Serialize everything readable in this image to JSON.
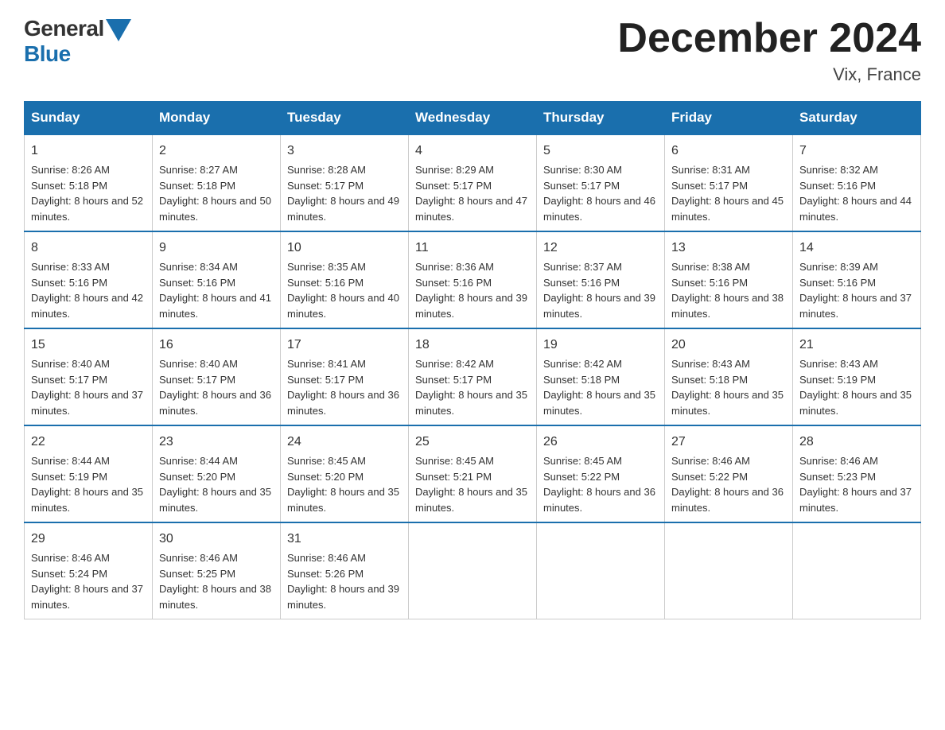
{
  "logo": {
    "general": "General",
    "blue": "Blue"
  },
  "header": {
    "title": "December 2024",
    "location": "Vix, France"
  },
  "days_of_week": [
    "Sunday",
    "Monday",
    "Tuesday",
    "Wednesday",
    "Thursday",
    "Friday",
    "Saturday"
  ],
  "weeks": [
    [
      {
        "num": "1",
        "sunrise": "8:26 AM",
        "sunset": "5:18 PM",
        "daylight": "8 hours and 52 minutes."
      },
      {
        "num": "2",
        "sunrise": "8:27 AM",
        "sunset": "5:18 PM",
        "daylight": "8 hours and 50 minutes."
      },
      {
        "num": "3",
        "sunrise": "8:28 AM",
        "sunset": "5:17 PM",
        "daylight": "8 hours and 49 minutes."
      },
      {
        "num": "4",
        "sunrise": "8:29 AM",
        "sunset": "5:17 PM",
        "daylight": "8 hours and 47 minutes."
      },
      {
        "num": "5",
        "sunrise": "8:30 AM",
        "sunset": "5:17 PM",
        "daylight": "8 hours and 46 minutes."
      },
      {
        "num": "6",
        "sunrise": "8:31 AM",
        "sunset": "5:17 PM",
        "daylight": "8 hours and 45 minutes."
      },
      {
        "num": "7",
        "sunrise": "8:32 AM",
        "sunset": "5:16 PM",
        "daylight": "8 hours and 44 minutes."
      }
    ],
    [
      {
        "num": "8",
        "sunrise": "8:33 AM",
        "sunset": "5:16 PM",
        "daylight": "8 hours and 42 minutes."
      },
      {
        "num": "9",
        "sunrise": "8:34 AM",
        "sunset": "5:16 PM",
        "daylight": "8 hours and 41 minutes."
      },
      {
        "num": "10",
        "sunrise": "8:35 AM",
        "sunset": "5:16 PM",
        "daylight": "8 hours and 40 minutes."
      },
      {
        "num": "11",
        "sunrise": "8:36 AM",
        "sunset": "5:16 PM",
        "daylight": "8 hours and 39 minutes."
      },
      {
        "num": "12",
        "sunrise": "8:37 AM",
        "sunset": "5:16 PM",
        "daylight": "8 hours and 39 minutes."
      },
      {
        "num": "13",
        "sunrise": "8:38 AM",
        "sunset": "5:16 PM",
        "daylight": "8 hours and 38 minutes."
      },
      {
        "num": "14",
        "sunrise": "8:39 AM",
        "sunset": "5:16 PM",
        "daylight": "8 hours and 37 minutes."
      }
    ],
    [
      {
        "num": "15",
        "sunrise": "8:40 AM",
        "sunset": "5:17 PM",
        "daylight": "8 hours and 37 minutes."
      },
      {
        "num": "16",
        "sunrise": "8:40 AM",
        "sunset": "5:17 PM",
        "daylight": "8 hours and 36 minutes."
      },
      {
        "num": "17",
        "sunrise": "8:41 AM",
        "sunset": "5:17 PM",
        "daylight": "8 hours and 36 minutes."
      },
      {
        "num": "18",
        "sunrise": "8:42 AM",
        "sunset": "5:17 PM",
        "daylight": "8 hours and 35 minutes."
      },
      {
        "num": "19",
        "sunrise": "8:42 AM",
        "sunset": "5:18 PM",
        "daylight": "8 hours and 35 minutes."
      },
      {
        "num": "20",
        "sunrise": "8:43 AM",
        "sunset": "5:18 PM",
        "daylight": "8 hours and 35 minutes."
      },
      {
        "num": "21",
        "sunrise": "8:43 AM",
        "sunset": "5:19 PM",
        "daylight": "8 hours and 35 minutes."
      }
    ],
    [
      {
        "num": "22",
        "sunrise": "8:44 AM",
        "sunset": "5:19 PM",
        "daylight": "8 hours and 35 minutes."
      },
      {
        "num": "23",
        "sunrise": "8:44 AM",
        "sunset": "5:20 PM",
        "daylight": "8 hours and 35 minutes."
      },
      {
        "num": "24",
        "sunrise": "8:45 AM",
        "sunset": "5:20 PM",
        "daylight": "8 hours and 35 minutes."
      },
      {
        "num": "25",
        "sunrise": "8:45 AM",
        "sunset": "5:21 PM",
        "daylight": "8 hours and 35 minutes."
      },
      {
        "num": "26",
        "sunrise": "8:45 AM",
        "sunset": "5:22 PM",
        "daylight": "8 hours and 36 minutes."
      },
      {
        "num": "27",
        "sunrise": "8:46 AM",
        "sunset": "5:22 PM",
        "daylight": "8 hours and 36 minutes."
      },
      {
        "num": "28",
        "sunrise": "8:46 AM",
        "sunset": "5:23 PM",
        "daylight": "8 hours and 37 minutes."
      }
    ],
    [
      {
        "num": "29",
        "sunrise": "8:46 AM",
        "sunset": "5:24 PM",
        "daylight": "8 hours and 37 minutes."
      },
      {
        "num": "30",
        "sunrise": "8:46 AM",
        "sunset": "5:25 PM",
        "daylight": "8 hours and 38 minutes."
      },
      {
        "num": "31",
        "sunrise": "8:46 AM",
        "sunset": "5:26 PM",
        "daylight": "8 hours and 39 minutes."
      },
      null,
      null,
      null,
      null
    ]
  ]
}
